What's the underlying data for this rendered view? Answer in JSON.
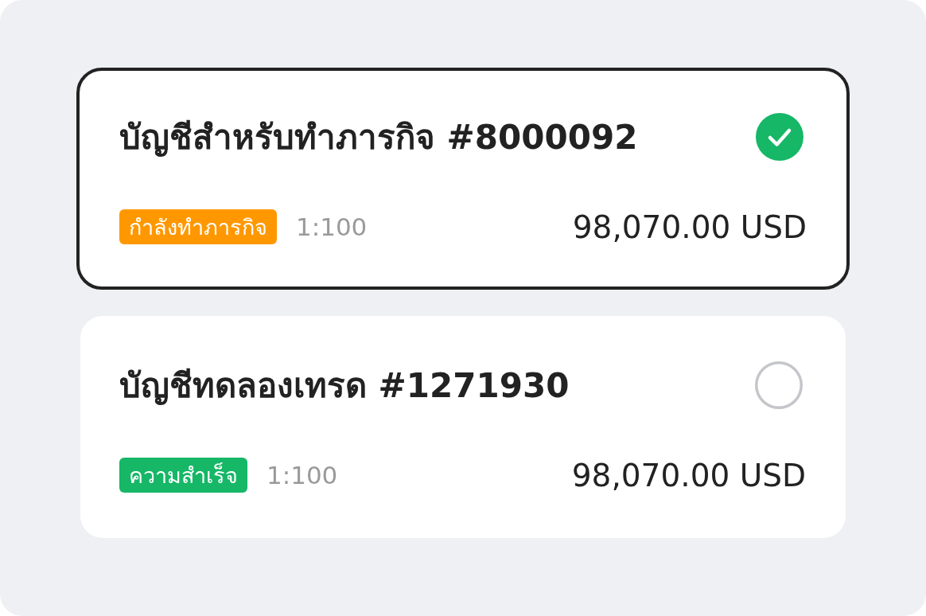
{
  "accounts": [
    {
      "name": "บัญชีสำหรับทำภารกิจ #8000092",
      "selected": true,
      "status": {
        "label": "กำลังทำภารกิจ",
        "color": "#ff9800"
      },
      "leverage": "1:100",
      "balance": "98,070.00 USD"
    },
    {
      "name": "บัญชีทดลองเทรด #1271930",
      "selected": false,
      "status": {
        "label": "ความสำเร็จ",
        "color": "#16b766"
      },
      "leverage": "1:100",
      "balance": "98,070.00 USD"
    }
  ]
}
